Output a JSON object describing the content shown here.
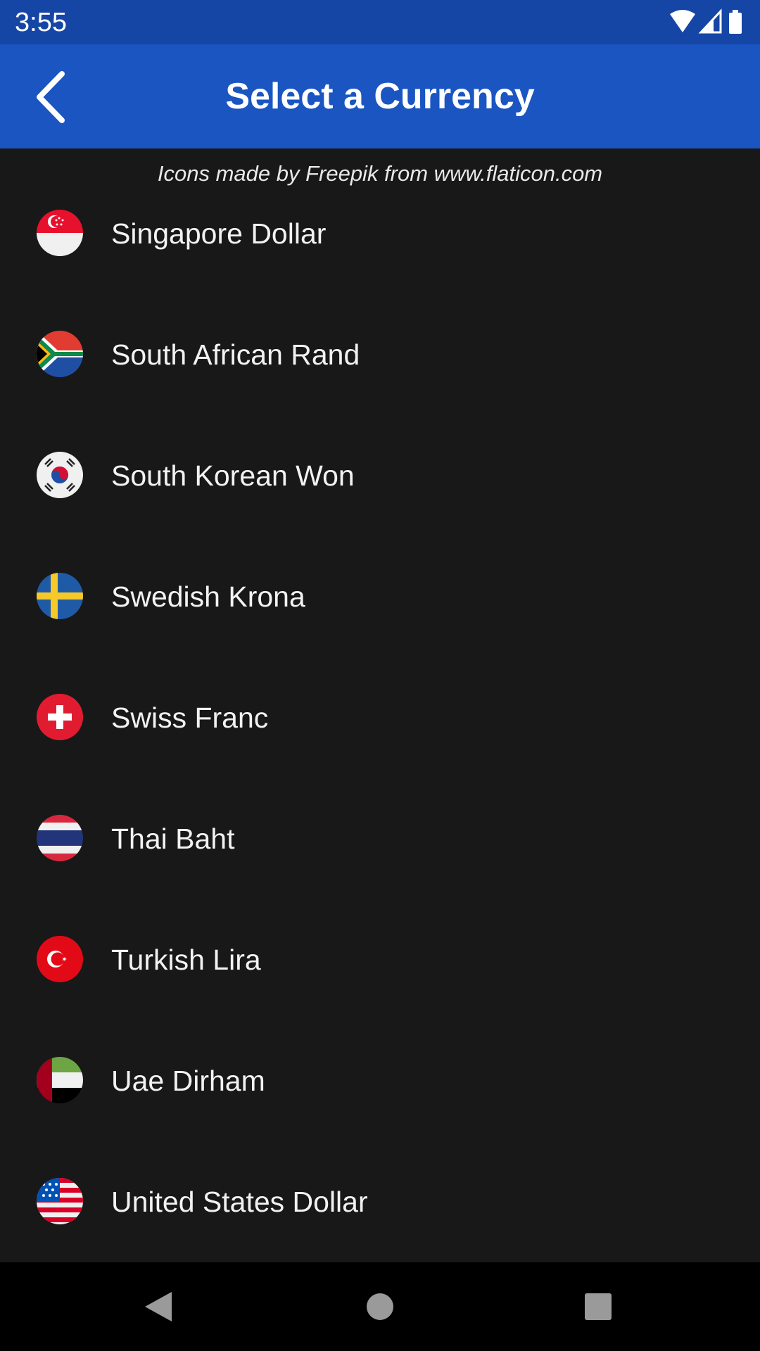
{
  "status_bar": {
    "time": "3:55",
    "icons": [
      "wifi-icon",
      "signal-icon",
      "battery-icon"
    ]
  },
  "app_bar": {
    "title": "Select a Currency",
    "back_icon": "back-arrow-icon",
    "background_color": "#1A55C2"
  },
  "attribution": "Icons made by Freepik from www.flaticon.com",
  "currencies": [
    {
      "name": "Singapore Dollar",
      "flag_icon": "singapore-flag-icon"
    },
    {
      "name": "South African Rand",
      "flag_icon": "south-africa-flag-icon"
    },
    {
      "name": "South Korean Won",
      "flag_icon": "south-korea-flag-icon"
    },
    {
      "name": "Swedish Krona",
      "flag_icon": "sweden-flag-icon"
    },
    {
      "name": "Swiss Franc",
      "flag_icon": "switzerland-flag-icon"
    },
    {
      "name": "Thai Baht",
      "flag_icon": "thailand-flag-icon"
    },
    {
      "name": "Turkish Lira",
      "flag_icon": "turkey-flag-icon"
    },
    {
      "name": "Uae Dirham",
      "flag_icon": "uae-flag-icon"
    },
    {
      "name": "United States Dollar",
      "flag_icon": "usa-flag-icon"
    }
  ],
  "nav_bar": {
    "buttons": [
      "nav-back-icon",
      "nav-home-icon",
      "nav-recents-icon"
    ]
  },
  "colors": {
    "status_bar": "#1646A5",
    "app_bar": "#1A55C2",
    "background": "#181818",
    "text": "#F2F2F2"
  }
}
